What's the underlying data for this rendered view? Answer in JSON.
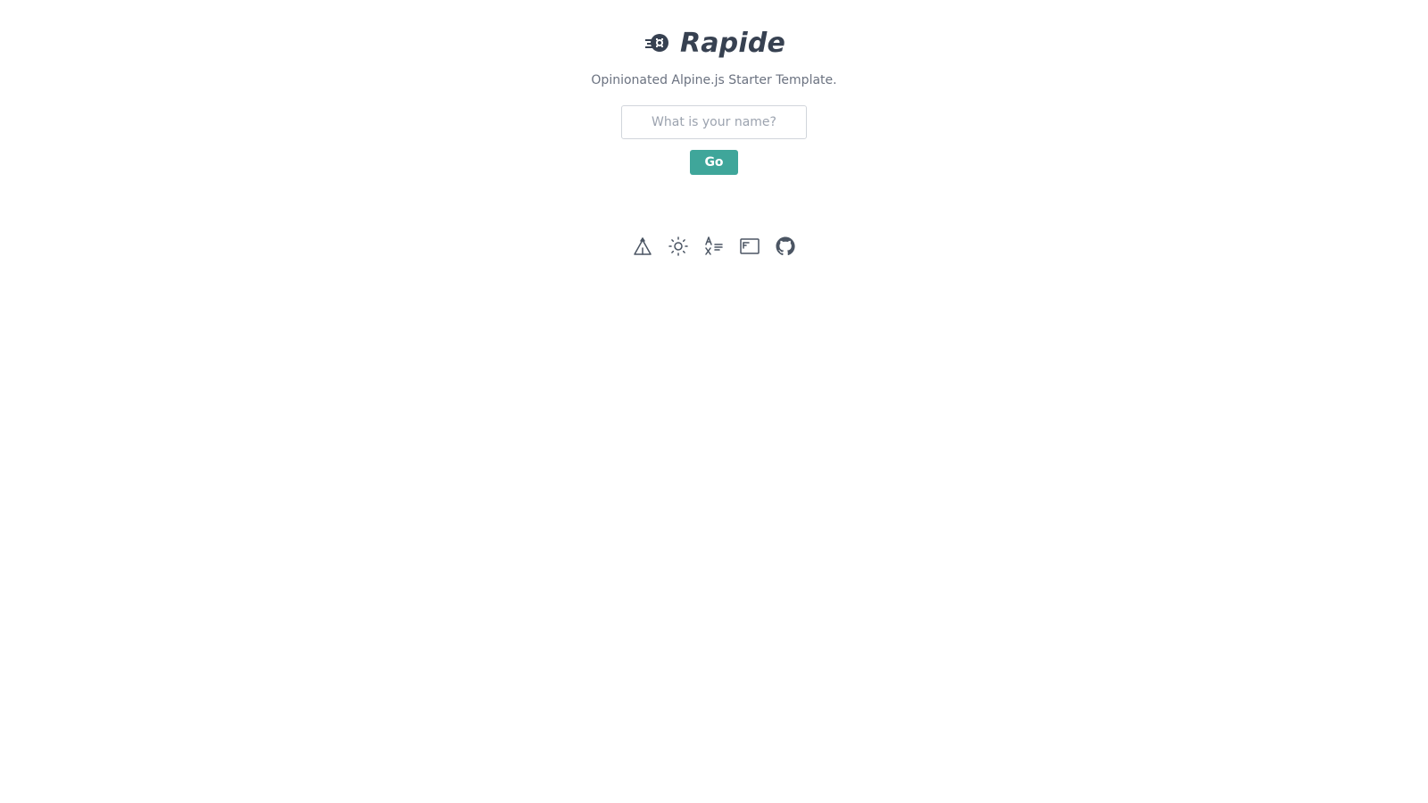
{
  "brand": {
    "title": "Rapide",
    "icon": "rocket-logo-icon"
  },
  "tagline": "Opinionated Alpine.js Starter Template.",
  "name_form": {
    "placeholder": "What is your name?",
    "value": "",
    "button_label": "Go"
  },
  "toolbar": {
    "icons": [
      "tent-icon",
      "sun-icon",
      "translate-icon",
      "window-icon",
      "github-icon"
    ]
  },
  "colors": {
    "accent": "#3fa69a",
    "text": "#374151",
    "muted": "#6b7280"
  }
}
